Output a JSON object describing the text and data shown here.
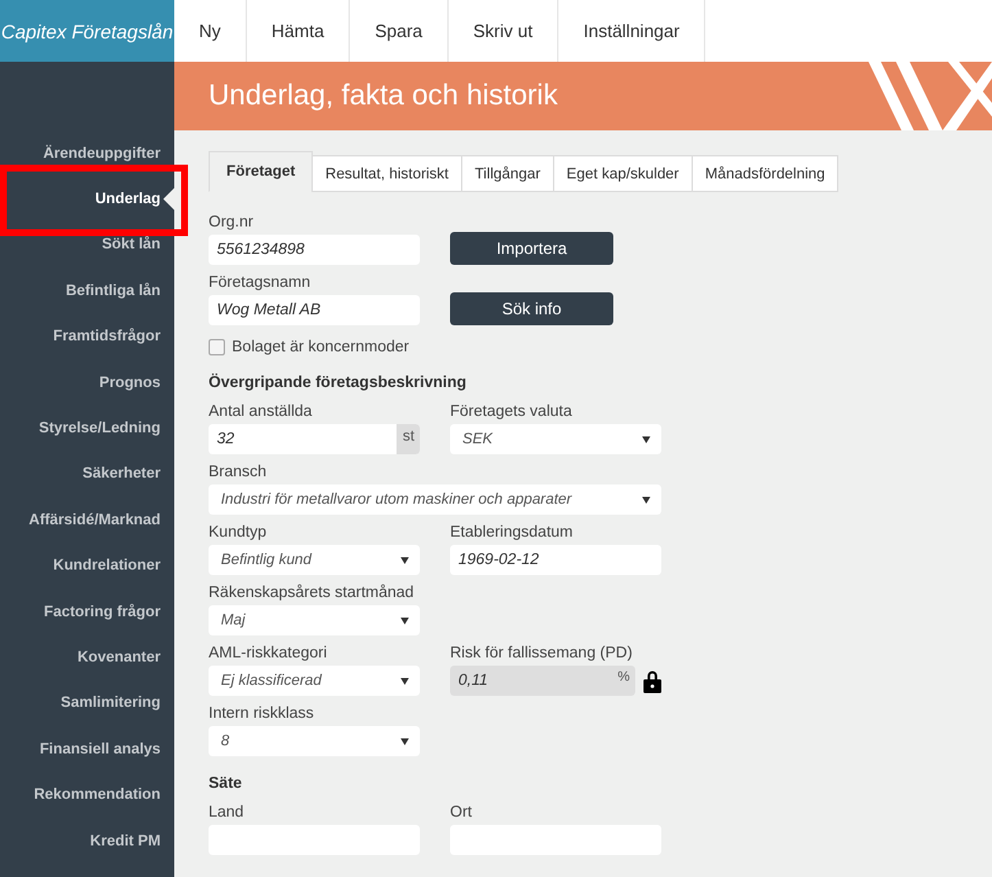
{
  "app": {
    "title": "Capitex Företagslån"
  },
  "menu": [
    {
      "label": "Ny"
    },
    {
      "label": "Hämta"
    },
    {
      "label": "Spara"
    },
    {
      "label": "Skriv ut"
    },
    {
      "label": "Inställningar"
    }
  ],
  "header": {
    "title": "Underlag, fakta och historik"
  },
  "sidebar": {
    "items": [
      {
        "label": "Ärendeuppgifter",
        "selected": false,
        "annotated": false
      },
      {
        "label": "Underlag",
        "selected": true,
        "annotated": true
      },
      {
        "label": "Sökt lån",
        "selected": false,
        "annotated": false
      },
      {
        "label": "Befintliga lån",
        "selected": false,
        "annotated": false
      },
      {
        "label": "Framtidsfrågor",
        "selected": false,
        "annotated": false
      },
      {
        "label": "Prognos",
        "selected": false,
        "annotated": false
      },
      {
        "label": "Styrelse/Ledning",
        "selected": false,
        "annotated": false
      },
      {
        "label": "Säkerheter",
        "selected": false,
        "annotated": false
      },
      {
        "label": "Affärsidé/Marknad",
        "selected": false,
        "annotated": false
      },
      {
        "label": "Kundrelationer",
        "selected": false,
        "annotated": false
      },
      {
        "label": "Factoring frågor",
        "selected": false,
        "annotated": false
      },
      {
        "label": "Kovenanter",
        "selected": false,
        "annotated": false
      },
      {
        "label": "Samlimitering",
        "selected": false,
        "annotated": false
      },
      {
        "label": "Finansiell analys",
        "selected": false,
        "annotated": false
      },
      {
        "label": "Rekommendation",
        "selected": false,
        "annotated": false
      },
      {
        "label": "Kredit PM",
        "selected": false,
        "annotated": false
      }
    ]
  },
  "tabs": [
    {
      "label": "Företaget",
      "selected": true
    },
    {
      "label": "Resultat, historiskt",
      "selected": false
    },
    {
      "label": "Tillgångar",
      "selected": false
    },
    {
      "label": "Eget kap/skulder",
      "selected": false
    },
    {
      "label": "Månadsfördelning",
      "selected": false
    }
  ],
  "sections": [
    {
      "rows": [
        [
          {
            "kind": "text",
            "label": "Org.nr",
            "value": "5561234898"
          },
          {
            "kind": "button",
            "label": "Importera"
          }
        ],
        [
          {
            "kind": "text",
            "label": "Företagsnamn",
            "value": "Wog Metall AB"
          },
          {
            "kind": "button",
            "label": "Sök info"
          }
        ],
        [
          {
            "kind": "checkbox",
            "label": "Bolaget är koncernmoder",
            "checked": false
          }
        ]
      ]
    },
    {
      "heading": "Övergripande företagsbeskrivning",
      "rows": [
        [
          {
            "kind": "unit",
            "label": "Antal anställda",
            "value": "32",
            "unit": "st"
          },
          {
            "kind": "select",
            "label": "Företagets valuta",
            "value": "SEK"
          }
        ],
        [
          {
            "kind": "select",
            "label": "Bransch",
            "value": "Industri för metallvaror utom maskiner och apparater",
            "wide": true
          }
        ],
        [
          {
            "kind": "select",
            "label": "Kundtyp",
            "value": "Befintlig kund"
          },
          {
            "kind": "text",
            "label": "Etableringsdatum",
            "value": "1969-02-12"
          }
        ],
        [
          {
            "kind": "select",
            "label": "Räkenskapsårets startmånad",
            "value": "Maj"
          }
        ],
        [
          {
            "kind": "select",
            "label": "AML-riskkategori",
            "value": "Ej klassificerad"
          },
          {
            "kind": "locked",
            "label": "Risk för fallissemang (PD)",
            "value": "0,11",
            "unit": "%"
          }
        ],
        [
          {
            "kind": "select",
            "label": "Intern riskklass",
            "value": "8"
          }
        ]
      ]
    },
    {
      "heading": "Säte",
      "rows": [
        [
          {
            "kind": "text",
            "label": "Land"
          },
          {
            "kind": "text",
            "label": "Ort"
          }
        ]
      ]
    }
  ]
}
